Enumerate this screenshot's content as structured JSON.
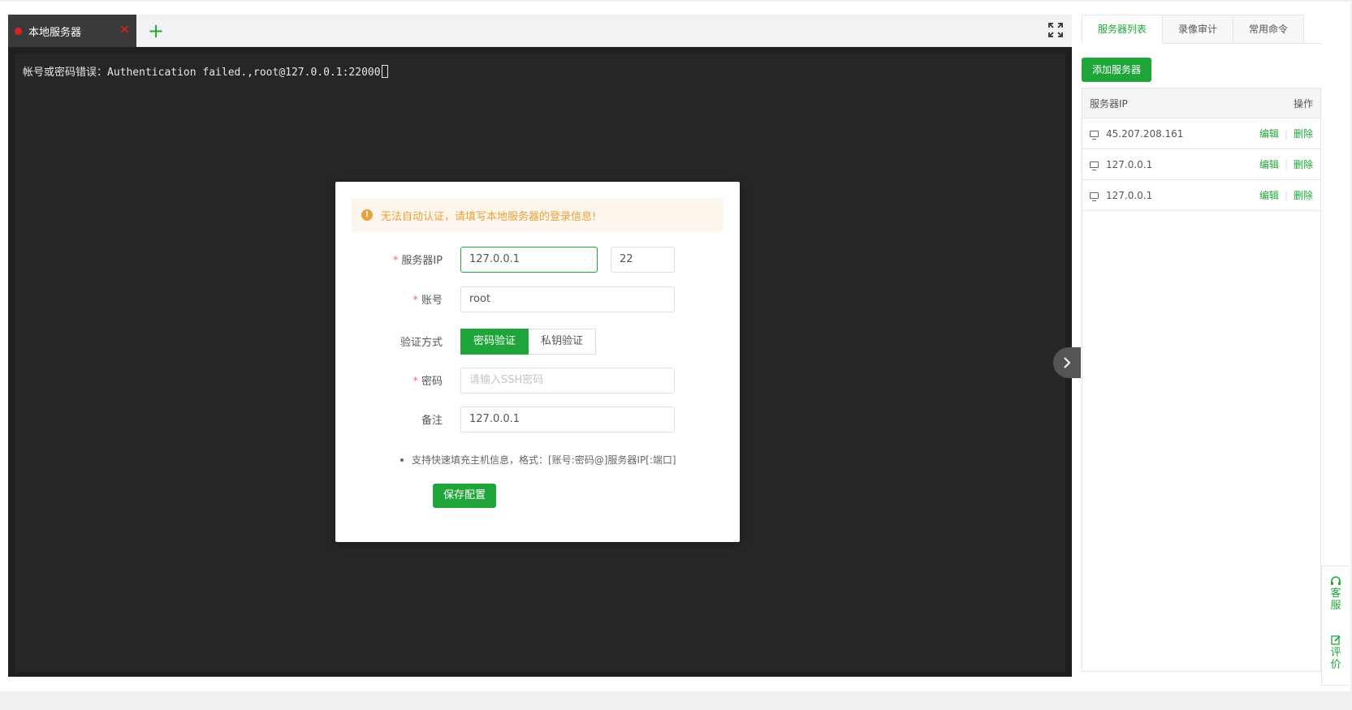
{
  "tab": {
    "label": "本地服务器",
    "close": "✕",
    "add": "+"
  },
  "terminal": {
    "line": "帐号或密码错误：Authentication failed.,root@127.0.0.1:22000"
  },
  "modal": {
    "alert": "无法自动认证，请填写本地服务器的登录信息!",
    "ip_label": "服务器IP",
    "ip_value": "127.0.0.1",
    "port_value": "22",
    "account_label": "账号",
    "account_value": "root",
    "auth_label": "验证方式",
    "auth_password": "密码验证",
    "auth_key": "私钥验证",
    "password_label": "密码",
    "password_placeholder": "请输入SSH密码",
    "note_label": "备注",
    "note_value": "127.0.0.1",
    "hint": "支持快速填充主机信息，格式：[账号:密码@]服务器IP[:端口]",
    "save": "保存配置",
    "required_mark": "*"
  },
  "right_panel": {
    "tabs": [
      {
        "label": "服务器列表",
        "active": true
      },
      {
        "label": "录像审计",
        "active": false
      },
      {
        "label": "常用命令",
        "active": false
      }
    ],
    "add_server": "添加服务器",
    "table": {
      "col_ip": "服务器IP",
      "col_actions": "操作",
      "edit": "编辑",
      "delete": "删除",
      "sep": "|",
      "rows": [
        {
          "ip": "45.207.208.161"
        },
        {
          "ip": "127.0.0.1"
        },
        {
          "ip": "127.0.0.1"
        }
      ]
    }
  },
  "float": {
    "service_1": "客",
    "service_2": "服",
    "review_1": "评",
    "review_2": "价"
  },
  "colors": {
    "accent": "#20a53a",
    "warning": "#e6a23c",
    "danger": "#e02020",
    "terminal_bg": "#262626"
  },
  "icons": [
    "red-dot-icon",
    "close-icon",
    "plus-icon",
    "fullscreen-icon",
    "chevron-right-icon",
    "warning-icon",
    "monitor-icon",
    "headset-icon",
    "edit-icon"
  ]
}
